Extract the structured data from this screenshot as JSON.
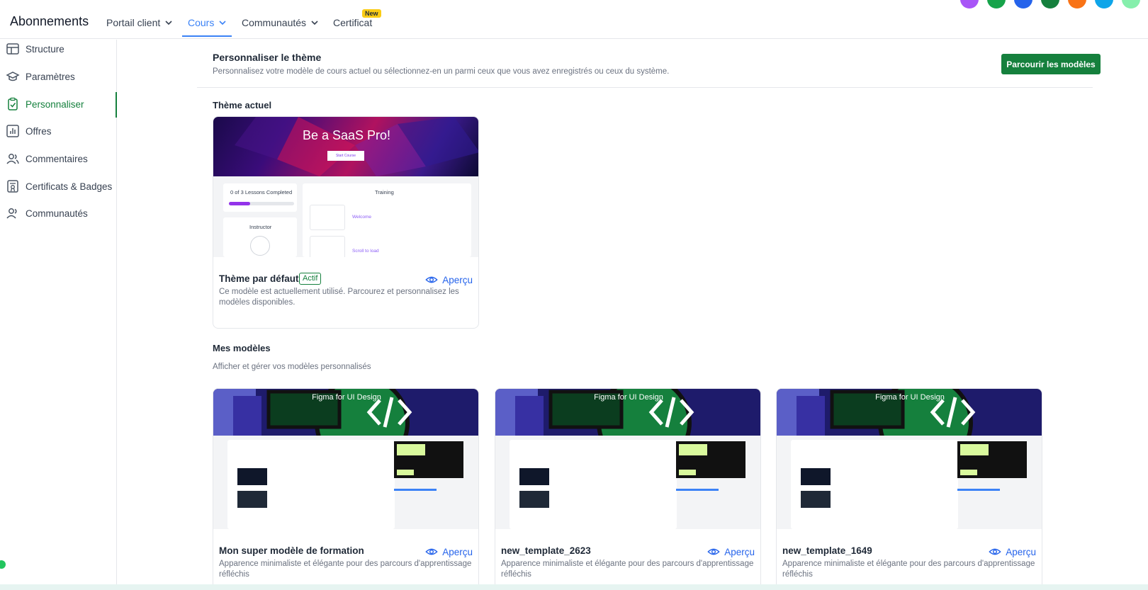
{
  "topnav": {
    "brand": "Abonnements",
    "items": [
      {
        "label": "Portail client"
      },
      {
        "label": "Cours"
      },
      {
        "label": "Communautés"
      },
      {
        "label": "Certificat"
      }
    ],
    "new_badge": "New",
    "avatar_colors": [
      "#a855f7",
      "#16a34a",
      "#2563eb",
      "#15803d",
      "#f97316",
      "#0ea5e9",
      "#86efac"
    ]
  },
  "sidebar": {
    "items": [
      {
        "label": "Structure",
        "icon": "table-icon"
      },
      {
        "label": "Paramètres",
        "icon": "graduation-cap-icon"
      },
      {
        "label": "Personnaliser",
        "icon": "clipboard-check-icon"
      },
      {
        "label": "Offres",
        "icon": "bar-chart-icon"
      },
      {
        "label": "Commentaires",
        "icon": "users-icon"
      },
      {
        "label": "Certificats & Badges",
        "icon": "certificate-icon"
      },
      {
        "label": "Communautés",
        "icon": "people-icon"
      }
    ],
    "active_index": 2
  },
  "header": {
    "title": "Personnaliser le thème",
    "subtitle": "Personnalisez votre modèle de cours actuel ou sélectionnez-en un parmi ceux que vous avez enregistrés ou ceux du système.",
    "browse_button": "Parcourir les modèles"
  },
  "current_theme": {
    "section_title": "Thème actuel",
    "card": {
      "title": "Thème par défaut",
      "badge": "Actif",
      "preview_label": "Aperçu",
      "description": "Ce modèle est actuellement utilisé. Parcourez et personnalisez les modèles disponibles.",
      "thumb": {
        "hero_title": "Be a SaaS Pro!",
        "hero_button": "Start Course",
        "progress_text": "0 of 3 Lessons Completed",
        "progress": 0.33,
        "instructor": "Instructor",
        "training": "Training",
        "lesson1": "Welcome",
        "lesson2": "Scroll to load"
      }
    }
  },
  "my_templates": {
    "section_title": "Mes modèles",
    "section_subtitle": "Afficher et gérer vos modèles personnalisés",
    "cards": [
      {
        "title": "Mon super modèle de formation",
        "preview_label": "Aperçu",
        "description": "Apparence minimaliste et élégante pour des parcours d'apprentissage réfléchis",
        "thumb_title": "Figma for UI Design"
      },
      {
        "title": "new_template_2623",
        "preview_label": "Aperçu",
        "description": "Apparence minimaliste et élégante pour des parcours d'apprentissage réfléchis",
        "thumb_title": "Figma for UI Design"
      },
      {
        "title": "new_template_1649",
        "preview_label": "Aperçu",
        "description": "Apparence minimaliste et élégante pour des parcours d'apprentissage réfléchis",
        "thumb_title": "Figma for UI Design"
      }
    ]
  },
  "colors": {
    "accent_green": "#15803d",
    "link_blue": "#2563eb",
    "nav_active": "#3b82f6"
  }
}
